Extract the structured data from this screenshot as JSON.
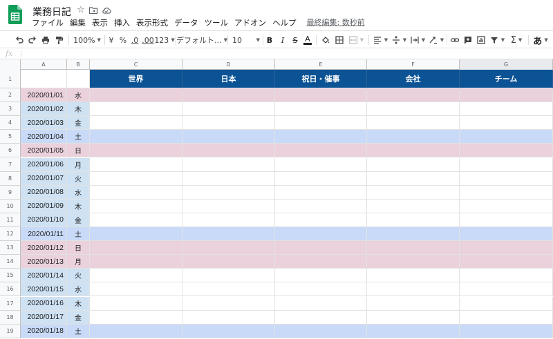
{
  "app": {
    "doc_title": "業務日記",
    "last_edit": "最終編集: 数秒前",
    "colors": {
      "header_fill": "#0b5394",
      "weekday_fill": "#cfe2f3",
      "saturday_fill": "#c9daf8",
      "holiday_fill": "#ead1dc",
      "white": "#ffffff",
      "sheets_green": "#0f9d58"
    }
  },
  "title_icons": [
    "star-icon",
    "move-to-folder-icon",
    "cloud-status-icon"
  ],
  "menu": [
    "ファイル",
    "編集",
    "表示",
    "挿入",
    "表示形式",
    "データ",
    "ツール",
    "アドオン",
    "ヘルプ"
  ],
  "toolbar": {
    "zoom": "100%",
    "currency": "¥",
    "percent": "%",
    "dec_decrease": ".0",
    "dec_increase": ".00",
    "more_formats": "123",
    "font": "デフォルト...",
    "font_size": "10",
    "bold": "B",
    "italic": "I",
    "strike": "S",
    "text_color": "A",
    "sigma": "Σ",
    "input_tools": "あ"
  },
  "formula_bar": {
    "fx": "fx",
    "value": ""
  },
  "columns": [
    "A",
    "B",
    "C",
    "D",
    "E",
    "F",
    "G"
  ],
  "header_row": {
    "number": "1",
    "labels": [
      "",
      "",
      "世界",
      "日本",
      "祝日・催事",
      "会社",
      "チーム"
    ]
  },
  "rows": [
    {
      "n": "2",
      "date": "2020/01/01",
      "dow": "水",
      "type": "holiday"
    },
    {
      "n": "3",
      "date": "2020/01/02",
      "dow": "木",
      "type": "weekday"
    },
    {
      "n": "4",
      "date": "2020/01/03",
      "dow": "金",
      "type": "weekday"
    },
    {
      "n": "5",
      "date": "2020/01/04",
      "dow": "土",
      "type": "saturday"
    },
    {
      "n": "6",
      "date": "2020/01/05",
      "dow": "日",
      "type": "holiday"
    },
    {
      "n": "7",
      "date": "2020/01/06",
      "dow": "月",
      "type": "weekday"
    },
    {
      "n": "8",
      "date": "2020/01/07",
      "dow": "火",
      "type": "weekday"
    },
    {
      "n": "9",
      "date": "2020/01/08",
      "dow": "水",
      "type": "weekday"
    },
    {
      "n": "10",
      "date": "2020/01/09",
      "dow": "木",
      "type": "weekday"
    },
    {
      "n": "11",
      "date": "2020/01/10",
      "dow": "金",
      "type": "weekday"
    },
    {
      "n": "12",
      "date": "2020/01/11",
      "dow": "土",
      "type": "saturday"
    },
    {
      "n": "13",
      "date": "2020/01/12",
      "dow": "日",
      "type": "holiday"
    },
    {
      "n": "14",
      "date": "2020/01/13",
      "dow": "月",
      "type": "holiday"
    },
    {
      "n": "15",
      "date": "2020/01/14",
      "dow": "火",
      "type": "weekday"
    },
    {
      "n": "16",
      "date": "2020/01/15",
      "dow": "水",
      "type": "weekday"
    },
    {
      "n": "17",
      "date": "2020/01/16",
      "dow": "木",
      "type": "weekday"
    },
    {
      "n": "18",
      "date": "2020/01/17",
      "dow": "金",
      "type": "weekday"
    },
    {
      "n": "19",
      "date": "2020/01/18",
      "dow": "土",
      "type": "saturday"
    }
  ]
}
